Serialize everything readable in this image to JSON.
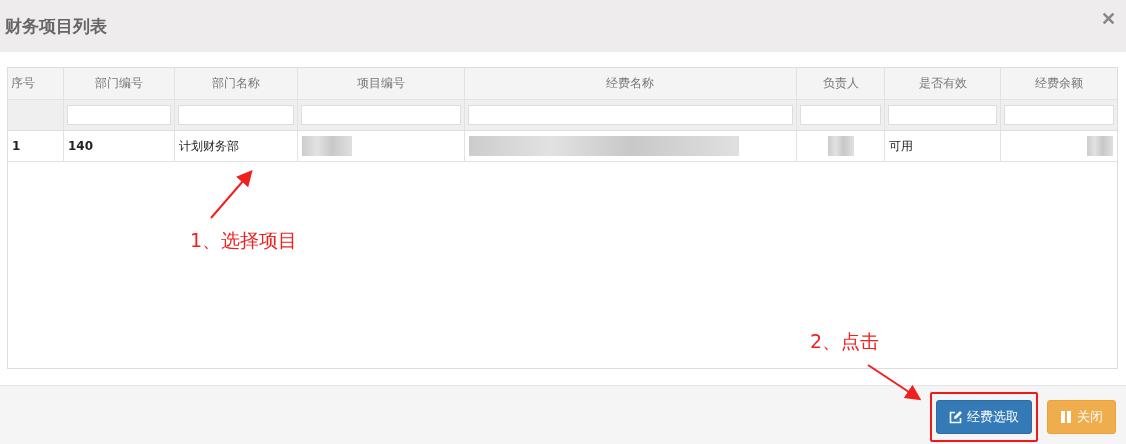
{
  "dialog": {
    "title": "财务项目列表",
    "close": "✕"
  },
  "table": {
    "columns": [
      "序号",
      "部门编号",
      "部门名称",
      "项目编号",
      "经费名称",
      "负责人",
      "是否有效",
      "经费余额"
    ],
    "rows": [
      {
        "selected": false,
        "cells": [
          {
            "kind": "bold",
            "text": "1"
          },
          {
            "kind": "bold",
            "text": "140"
          },
          {
            "kind": "text",
            "text": "计划财务部"
          },
          {
            "kind": "redacted"
          },
          {
            "kind": "redacted"
          },
          {
            "kind": "redacted"
          },
          {
            "kind": "text",
            "text": "可用"
          },
          {
            "kind": "redacted"
          }
        ]
      }
    ]
  },
  "annotations": [
    {
      "text": "1、选择项目"
    },
    {
      "text": "2、点击"
    }
  ],
  "buttons": [
    {
      "kind": "primary",
      "label": "经费选取"
    },
    {
      "kind": "warning",
      "label": "关闭"
    }
  ]
}
